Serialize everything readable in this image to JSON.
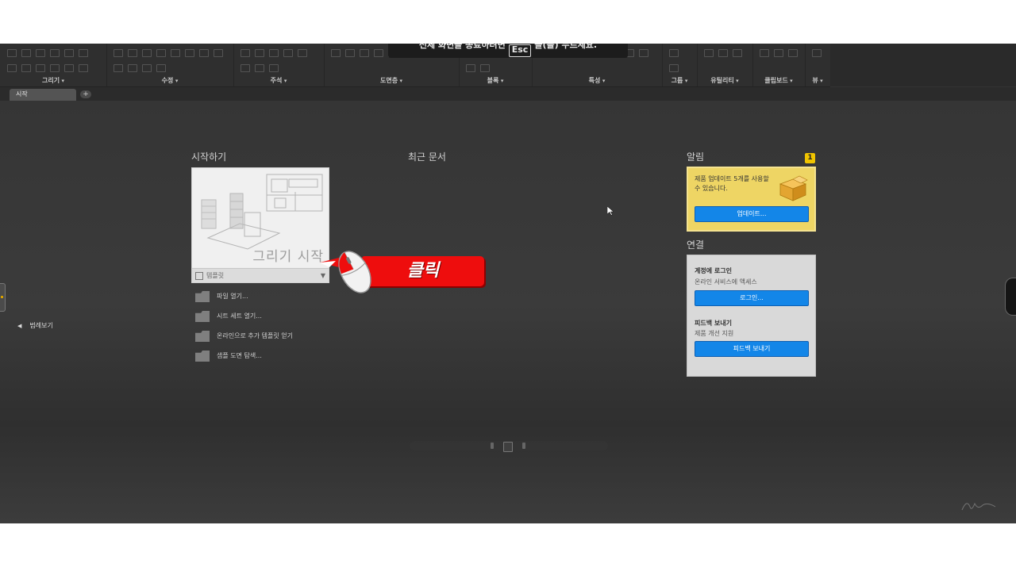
{
  "ribbon": {
    "notice": {
      "before": "전체 화면을 종료하려면",
      "key": "Esc",
      "after": "을(를) 누르세요."
    },
    "panels": [
      {
        "label": "그리기"
      },
      {
        "label": "수정"
      },
      {
        "label": "주석"
      },
      {
        "label": "도면층"
      },
      {
        "label": "블록"
      },
      {
        "label": "특성"
      },
      {
        "label": "그룹"
      },
      {
        "label": "유틸리티"
      },
      {
        "label": "클립보드"
      },
      {
        "label": "뷰"
      }
    ]
  },
  "tabs": [
    {
      "label": "시작"
    }
  ],
  "new_tab": "+",
  "left_panel": {
    "preview_label": "범례보기"
  },
  "get_started": {
    "heading": "시작하기",
    "start_drawing": "그리기 시작",
    "template_label": "템플릿",
    "links": [
      {
        "label": "파일 열기...",
        "icon": "folder-icon"
      },
      {
        "label": "시트 세트 열기...",
        "icon": "sheet-set-icon"
      },
      {
        "label": "온라인으로 추가 템플릿 얻기",
        "icon": "template-online-icon"
      },
      {
        "label": "샘플 도면 탐색...",
        "icon": "sample-drawing-icon"
      }
    ]
  },
  "recent_documents": {
    "heading": "최근 문서"
  },
  "notifications": {
    "heading": "알림",
    "badge": "1",
    "message": "제품 업데이트 5개를 사용할 수 있습니다.",
    "button": "업데이트..."
  },
  "connect": {
    "heading": "연결",
    "sign_in_title": "계정에 로그인",
    "sign_in_desc": "온라인 서비스에 액세스",
    "sign_in_button": "로그인...",
    "feedback_title": "피드백 보내기",
    "feedback_desc": "제품 개선 지원",
    "feedback_button": "피드백 보내기"
  },
  "callout": {
    "label": "클릭",
    "color": "#ee0d0d"
  },
  "pager": {
    "pages": 3,
    "current": 2
  },
  "colors": {
    "accent_blue": "#1386e8",
    "alert_yellow": "#eed564",
    "background": "#3b3b3b"
  }
}
